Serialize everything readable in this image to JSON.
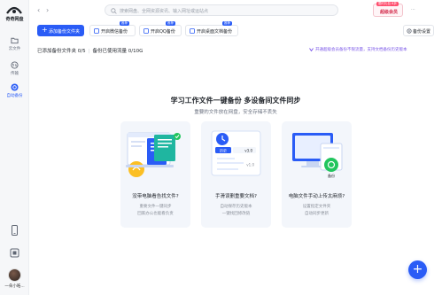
{
  "app": {
    "logo_text": "奇奇网盘"
  },
  "sidebar": {
    "items": [
      {
        "label": "云文件",
        "icon": "folder-icon",
        "active": false
      },
      {
        "label": "传输",
        "icon": "transfer-icon",
        "active": false
      },
      {
        "label": "自动备份",
        "icon": "backup-icon",
        "active": true
      }
    ],
    "phone_icon": "phone-icon",
    "box_icon": "box-icon",
    "user_name": "一朵小皓..."
  },
  "topbar": {
    "search_placeholder": "搜索网盘、全网资源资讯、输入网址或运站点",
    "member_tag": "限时礼包 8折",
    "member_label": "超级会员"
  },
  "actions": {
    "add_folder": "添加备份文件夹",
    "wechat_backup": "开启微信备份",
    "qq_backup": "开启QQ备份",
    "desktop_backup": "开启桌面文档备份",
    "badge_text": "推荐",
    "settings": "备份设置"
  },
  "stats": {
    "added_folders": "已添加备份文件夹 0/5",
    "used_traffic": "备份已使用流量 0/10G"
  },
  "promo": "开通超级会员备份不限流量，支持文档备份历史版本",
  "hero": {
    "title": "学习工作文件一键备份   多设备间文件同步",
    "subtitle": "重要的文件放在网盘，安全存储不丢失"
  },
  "cards": [
    {
      "title": "没带电脑看告找文件?",
      "desc1": "重要文件一键同步",
      "desc2": "回家办公也能看负责"
    },
    {
      "title": "手滑误删重要文档?",
      "desc1": "自动保存历史版本",
      "desc2": "一键找回修改链",
      "version_new": "v3.0",
      "version_old": "v1.0",
      "history_label": "历史"
    },
    {
      "title": "电脑文件手动上传太麻烦?",
      "desc1": "设置指定文件夹",
      "desc2": "自动同步更新",
      "backup_label": "备份"
    }
  ],
  "colors": {
    "accent": "#2a5cf6",
    "promo": "#7a56e8",
    "member": "#d4304f"
  }
}
